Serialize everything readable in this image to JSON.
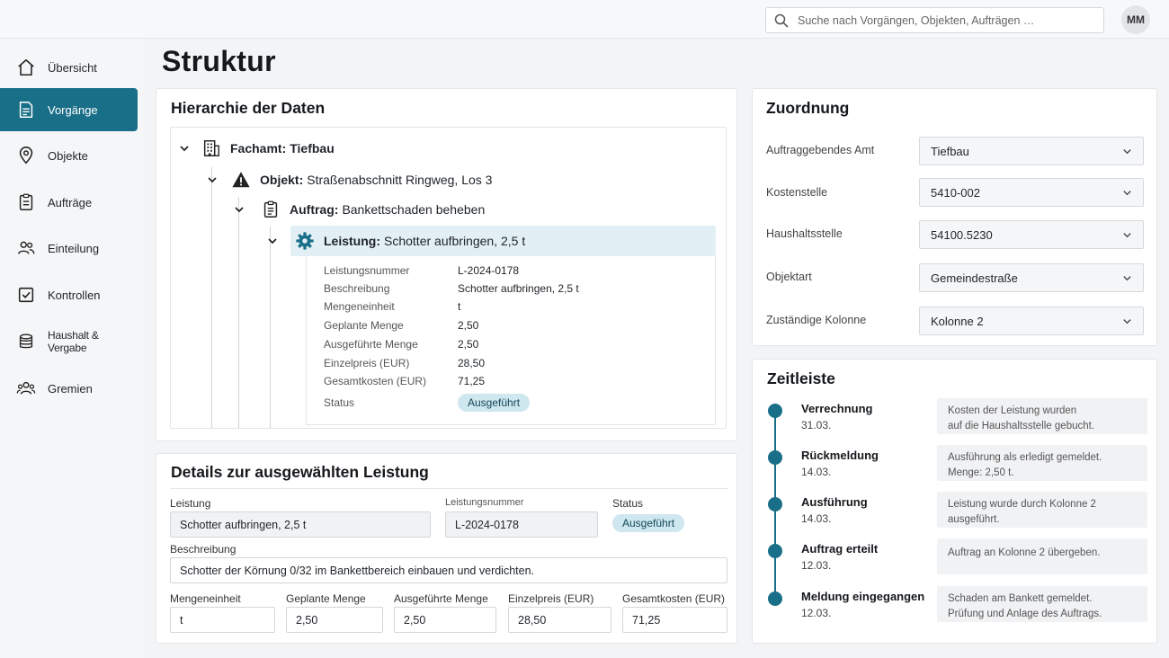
{
  "search": {
    "placeholder": "Suche nach Vorgängen, Objekten, Aufträgen …"
  },
  "user": {
    "initials": "MM"
  },
  "sidebar": {
    "items": [
      {
        "label": "Übersicht",
        "icon": "home-icon"
      },
      {
        "label": "Vorgänge",
        "icon": "document-icon",
        "active": true
      },
      {
        "label": "Objekte",
        "icon": "map-pin-icon"
      },
      {
        "label": "Aufträge",
        "icon": "clipboard-icon"
      },
      {
        "label": "Einteilung",
        "icon": "users-icon"
      },
      {
        "label": "Kontrollen",
        "icon": "checkbox-icon"
      },
      {
        "label": "Haushalt & Vergabe",
        "icon": "coins-icon"
      },
      {
        "label": "Gremien",
        "icon": "group-icon"
      }
    ]
  },
  "page": {
    "title": "Struktur"
  },
  "hierarchy": {
    "title": "Hierarchie der Daten",
    "fachamt": {
      "label": "Fachamt:",
      "value": "Tiefbau"
    },
    "objekt": {
      "label": "Objekt:",
      "value": "Straßenabschnitt Ringweg, Los 3"
    },
    "auftrag": {
      "label": "Auftrag:",
      "value": "Bankettschaden beheben"
    },
    "leistung": {
      "label": "Leistung:",
      "value": "Schotter aufbringen, 2,5 t"
    },
    "details": [
      {
        "key": "Leistungsnummer",
        "value": "L-2024-0178"
      },
      {
        "key": "Beschreibung",
        "value": "Schotter aufbringen, 2,5 t"
      },
      {
        "key": "Mengeneinheit",
        "value": "t"
      },
      {
        "key": "Geplante Menge",
        "value": "2,50"
      },
      {
        "key": "Ausgeführte Menge",
        "value": "2,50"
      },
      {
        "key": "Einzelpreis (EUR)",
        "value": "28,50"
      },
      {
        "key": "Gesamtkosten (EUR)",
        "value": "71,25"
      }
    ],
    "status_key": "Status",
    "status_value": "Ausgeführt"
  },
  "details": {
    "title": "Details zur ausgewählten Leistung",
    "leistung_label": "Leistung",
    "leistung_value": "Schotter aufbringen, 2,5 t",
    "nummer_label": "Leistungsnummer",
    "nummer_value": "L-2024-0178",
    "status_label": "Status",
    "status_value": "Ausgeführt",
    "beschreibung_label": "Beschreibung",
    "beschreibung_value": "Schotter der Körnung 0/32 im Bankettbereich einbauen und verdichten.",
    "mengeneinheit_label": "Mengeneinheit",
    "mengeneinheit_value": "t",
    "geplant_label": "Geplante Menge",
    "geplant_value": "2,50",
    "ausgefuehrt_label": "Ausgeführte Menge",
    "ausgefuehrt_value": "2,50",
    "einzelpreis_label": "Einzelpreis (EUR)",
    "einzelpreis_value": "28,50",
    "gesamt_label": "Gesamtkosten (EUR)",
    "gesamt_value": "71,25"
  },
  "zuordnung": {
    "title": "Zuordnung",
    "rows": [
      {
        "label": "Auftraggebendes Amt",
        "value": "Tiefbau"
      },
      {
        "label": "Kostenstelle",
        "value": "5410-002"
      },
      {
        "label": "Haushaltsstelle",
        "value": "54100.5230"
      },
      {
        "label": "Objektart",
        "value": "Gemeindestraße"
      },
      {
        "label": "Zuständige Kolonne",
        "value": "Kolonne 2"
      }
    ]
  },
  "timeline": {
    "title": "Zeitleiste",
    "events": [
      {
        "title": "Verrechnung",
        "date": "31.03.",
        "note1": "Kosten der Leistung wurden",
        "note2": "auf die Haushaltsstelle gebucht."
      },
      {
        "title": "Rückmeldung",
        "date": "14.03.",
        "note1": "Ausführung als erledigt gemeldet.",
        "note2": "Menge: 2,50 t."
      },
      {
        "title": "Ausführung",
        "date": "14.03.",
        "note1": "Leistung wurde durch Kolonne 2",
        "note2": "ausgeführt."
      },
      {
        "title": "Auftrag erteilt",
        "date": "12.03.",
        "note1": "Auftrag an Kolonne 2 übergeben.",
        "note2": ""
      },
      {
        "title": "Meldung eingegangen",
        "date": "12.03.",
        "note1": "Schaden am Bankett gemeldet.",
        "note2": "Prüfung und Anlage des Auftrags."
      }
    ]
  },
  "colors": {
    "accent": "#1a6f88",
    "selected_row": "#e2f0f5",
    "badge": "#cfe7ef"
  }
}
